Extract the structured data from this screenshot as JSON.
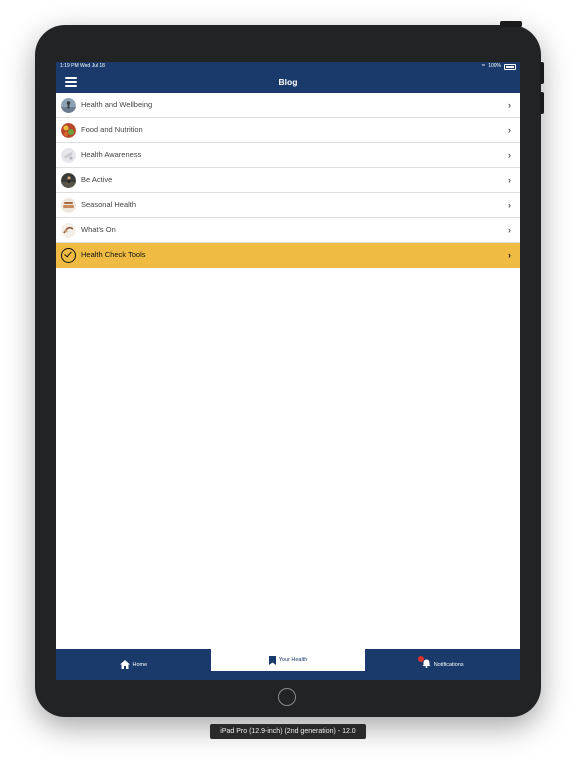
{
  "status_bar": {
    "time": "1:19 PM  Wed Jul 18",
    "battery": "100%"
  },
  "nav": {
    "title": "Blog"
  },
  "list": [
    {
      "label": "Health and Wellbeing",
      "icon": "health-wellbeing-thumbnail"
    },
    {
      "label": "Food and Nutrition",
      "icon": "food-nutrition-thumbnail"
    },
    {
      "label": "Health Awareness",
      "icon": "health-awareness-thumbnail"
    },
    {
      "label": "Be Active",
      "icon": "be-active-thumbnail"
    },
    {
      "label": "Seasonal Health",
      "icon": "seasonal-health-thumbnail"
    },
    {
      "label": "What's On",
      "icon": "whats-on-thumbnail"
    }
  ],
  "highlight_item": {
    "label": "Health Check Tools",
    "icon": "check-circle-icon",
    "color": "#f0bb42"
  },
  "tabs": [
    {
      "label": "Home",
      "icon": "home-icon"
    },
    {
      "label": "Your Health",
      "icon": "bookmark-icon",
      "active": true
    },
    {
      "label": "Notifications",
      "icon": "bell-icon",
      "badge": ""
    }
  ],
  "device_caption": "iPad Pro (12.9-inch) (2nd generation) - 12.0",
  "colors": {
    "primary": "#1a3a6b",
    "accent": "#f0bb42"
  }
}
